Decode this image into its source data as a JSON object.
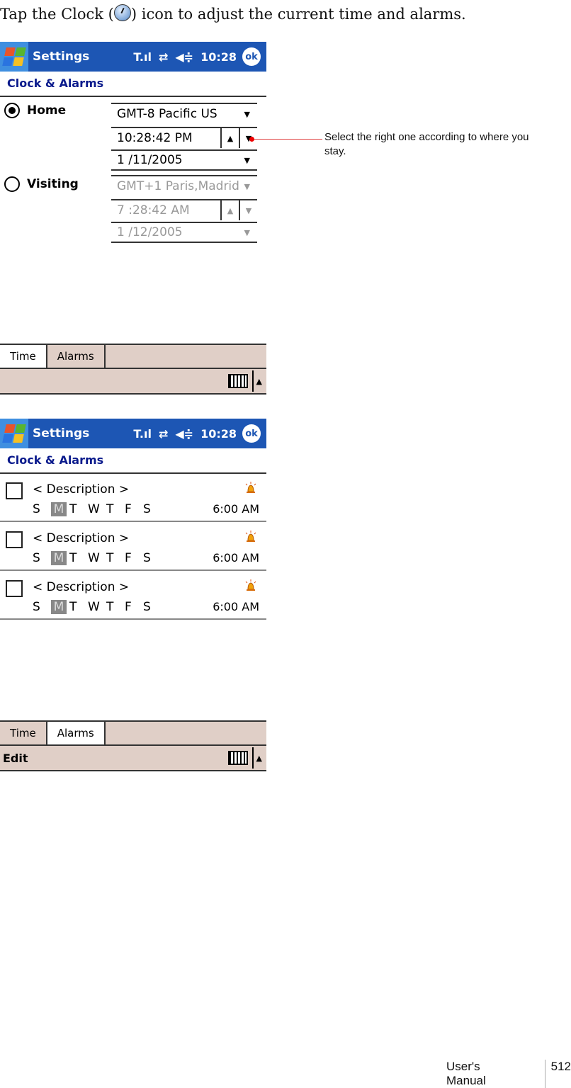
{
  "intro": {
    "before": "Tap the Clock (",
    "after": ") icon to adjust the current time and alarms."
  },
  "screens": [
    {
      "title": "Settings",
      "status_time": "10:28",
      "ok": "ok",
      "heading": "Clock & Alarms",
      "home": {
        "label": "Home",
        "selected": true,
        "timezone": "GMT-8 Pacific US",
        "time": "10:28:42 PM",
        "date": "1 /11/2005"
      },
      "visiting": {
        "label": "Visiting",
        "selected": false,
        "timezone": "GMT+1 Paris,Madrid",
        "time": "7 :28:42 AM",
        "date": "1 /12/2005"
      },
      "tabs": [
        "Time",
        "Alarms"
      ],
      "active_tab": "Time"
    },
    {
      "title": "Settings",
      "status_time": "10:28",
      "ok": "ok",
      "heading": "Clock & Alarms",
      "alarms": [
        {
          "description": "< Description >",
          "days": [
            "S",
            "M",
            "T",
            "W",
            "T",
            "F",
            "S"
          ],
          "selected_day": "M",
          "time": "6:00 AM",
          "checked": false
        },
        {
          "description": "< Description >",
          "days": [
            "S",
            "M",
            "T",
            "W",
            "T",
            "F",
            "S"
          ],
          "selected_day": "M",
          "time": "6:00 AM",
          "checked": false
        },
        {
          "description": "< Description >",
          "days": [
            "S",
            "M",
            "T",
            "W",
            "T",
            "F",
            "S"
          ],
          "selected_day": "M",
          "time": "6:00 AM",
          "checked": false
        }
      ],
      "tabs": [
        "Time",
        "Alarms"
      ],
      "active_tab": "Alarms",
      "menu_edit": "Edit"
    }
  ],
  "callout": "Select the right one according to where you stay.",
  "footer": {
    "manual": "User's Manual",
    "page": "512"
  }
}
